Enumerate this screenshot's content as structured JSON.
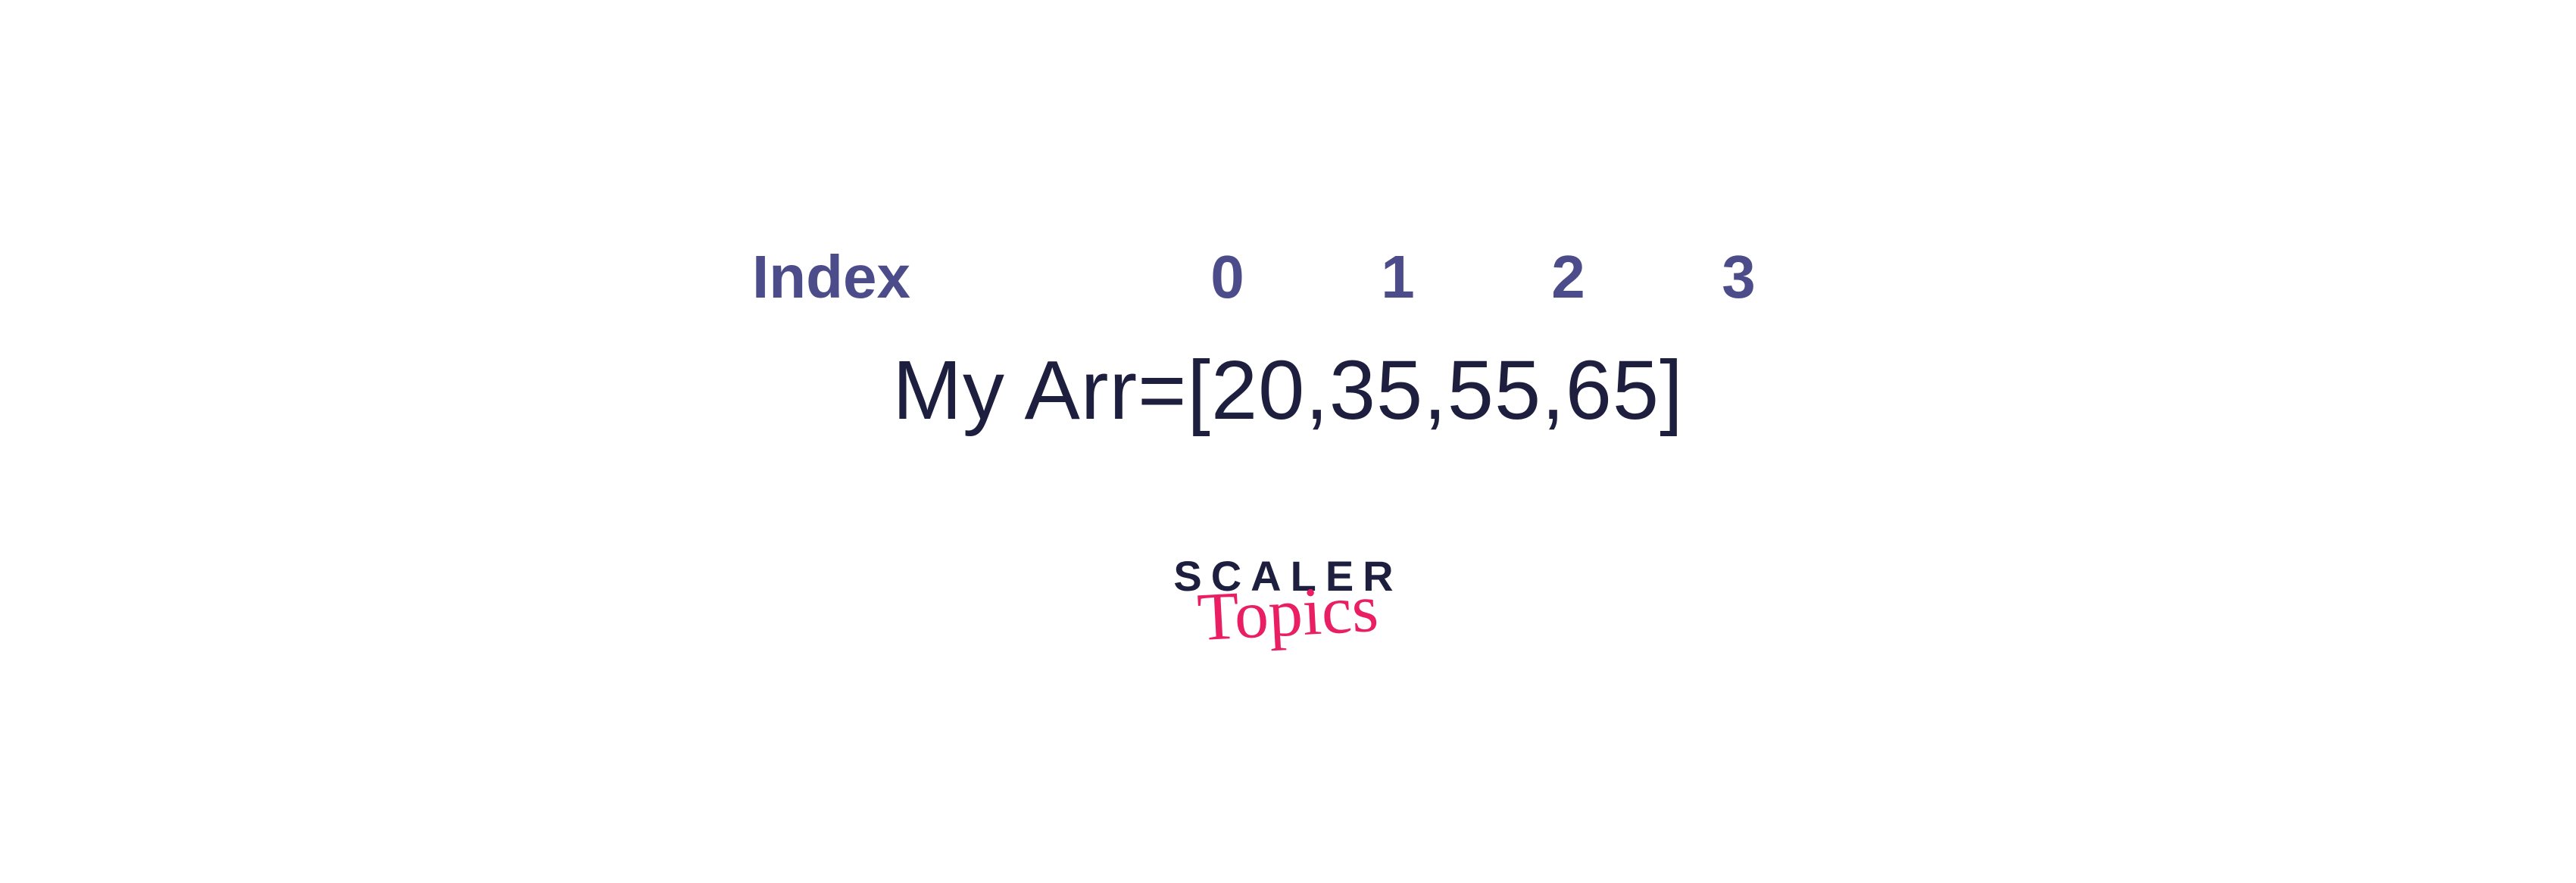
{
  "index_label": "Index",
  "indices": [
    "0",
    "1",
    "2",
    "3"
  ],
  "array_name": "My Arr",
  "array_equals": " = ",
  "array_open": "[ ",
  "array_values": [
    "20",
    "35",
    "55",
    "65"
  ],
  "array_sep": ", ",
  "array_close": " ]",
  "logo": {
    "line1": "SCALER",
    "line2": "Topics"
  }
}
